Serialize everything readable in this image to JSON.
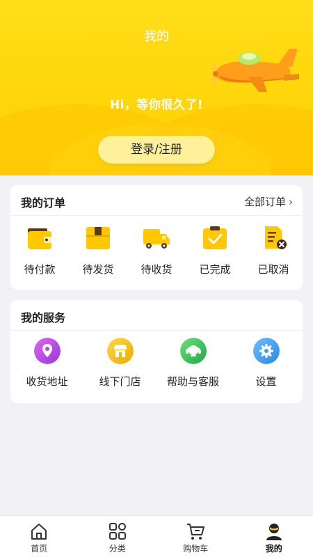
{
  "header": {
    "title": "我的",
    "greeting": "Hi，等你很久了!",
    "login_label": "登录/注册"
  },
  "orders": {
    "title": "我的订单",
    "all_label": "全部订单",
    "items": [
      {
        "label": "待付款",
        "icon": "wallet-icon"
      },
      {
        "label": "待发货",
        "icon": "package-icon"
      },
      {
        "label": "待收货",
        "icon": "truck-icon"
      },
      {
        "label": "已完成",
        "icon": "check-icon"
      },
      {
        "label": "已取消",
        "icon": "cancelled-doc-icon"
      }
    ]
  },
  "services": {
    "title": "我的服务",
    "items": [
      {
        "label": "收货地址",
        "icon": "location-pin-icon",
        "color": "#b048e0"
      },
      {
        "label": "线下门店",
        "icon": "store-icon",
        "color": "#f5b800"
      },
      {
        "label": "帮助与客服",
        "icon": "headset-icon",
        "color": "#3cc45a"
      },
      {
        "label": "设置",
        "icon": "gear-icon",
        "color": "#3a9ff0"
      }
    ]
  },
  "tabbar": {
    "items": [
      {
        "label": "首页",
        "icon": "home-icon"
      },
      {
        "label": "分类",
        "icon": "category-icon"
      },
      {
        "label": "购物车",
        "icon": "cart-icon"
      },
      {
        "label": "我的",
        "icon": "profile-icon"
      }
    ],
    "active": "我的"
  },
  "colors": {
    "brand_yellow": "#ffd60a",
    "login_button": "#fff09a",
    "background": "#f2f1f6"
  }
}
